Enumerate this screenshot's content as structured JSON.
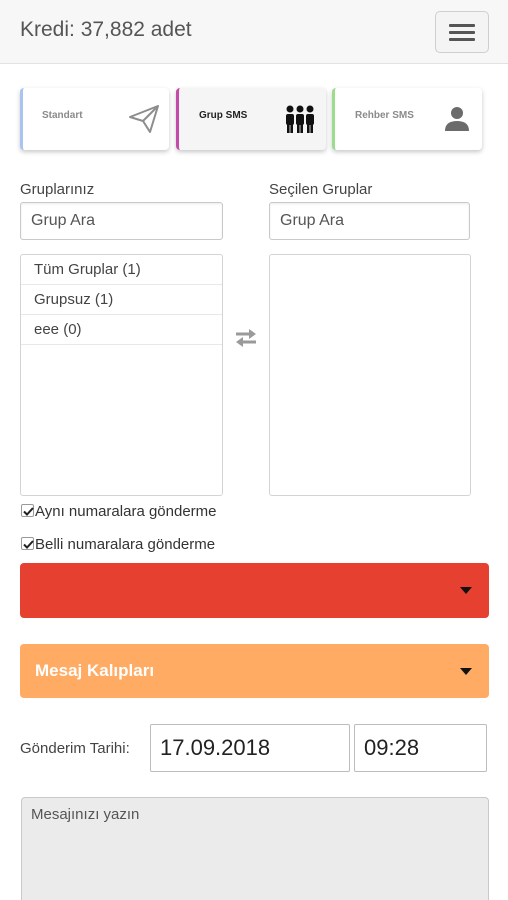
{
  "header": {
    "credit": "Kredi: 37,882 adet",
    "menu_icon": "hamburger-menu-icon"
  },
  "tabs": [
    {
      "label": "Standart",
      "icon": "paper-plane-icon",
      "accent": "#a9c3f2",
      "active": false
    },
    {
      "label": "Grup SMS",
      "icon": "group-people-icon",
      "accent": "#c44ba6",
      "active": true
    },
    {
      "label": "Rehber SMS",
      "icon": "person-icon",
      "accent": "#9cdc8e",
      "active": false
    }
  ],
  "groups": {
    "left_label": "Gruplarınız",
    "right_label": "Seçilen Gruplar",
    "left_search_placeholder": "Grup Ara",
    "right_search_placeholder": "Grup Ara",
    "items": [
      "Tüm Gruplar (1)",
      "Grupsuz (1)",
      "eee (0)"
    ],
    "selected_items": []
  },
  "options": {
    "same_numbers": {
      "label": "Aynı numaralara gönderme",
      "checked": true
    },
    "certain_numbers": {
      "label": "Belli numaralara gönderme",
      "checked": true
    }
  },
  "dropdowns": {
    "red": {
      "label": "",
      "color": "#e54030"
    },
    "templates": {
      "label": "Mesaj Kalıpları",
      "color": "#ffab63"
    }
  },
  "schedule": {
    "label": "Gönderim Tarihi:",
    "date": "17.09.2018",
    "time": "09:28"
  },
  "message": {
    "placeholder": "Mesajınızı yazın"
  }
}
